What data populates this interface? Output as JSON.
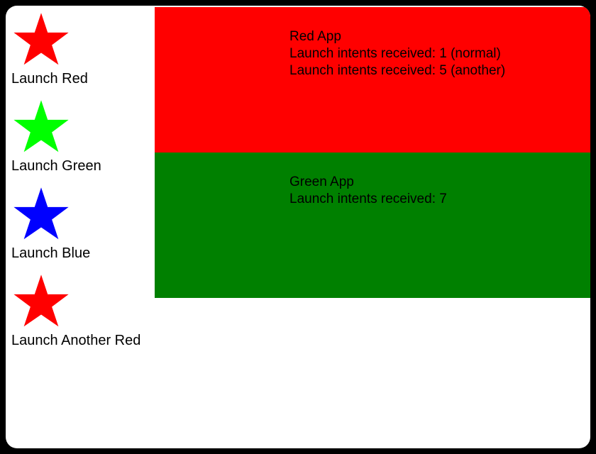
{
  "launchers": [
    {
      "label": "Launch Red",
      "color": "#ff0000"
    },
    {
      "label": "Launch Green",
      "color": "#00ff00"
    },
    {
      "label": "Launch Blue",
      "color": "#0000ff"
    },
    {
      "label": "Launch Another Red",
      "color": "#ff0000"
    }
  ],
  "panels": {
    "red": {
      "title": "Red App",
      "line1": "Launch intents received: 1 (normal)",
      "line2": "Launch intents received: 5 (another)"
    },
    "green": {
      "title": "Green App",
      "line1": "Launch intents received: 7"
    }
  }
}
